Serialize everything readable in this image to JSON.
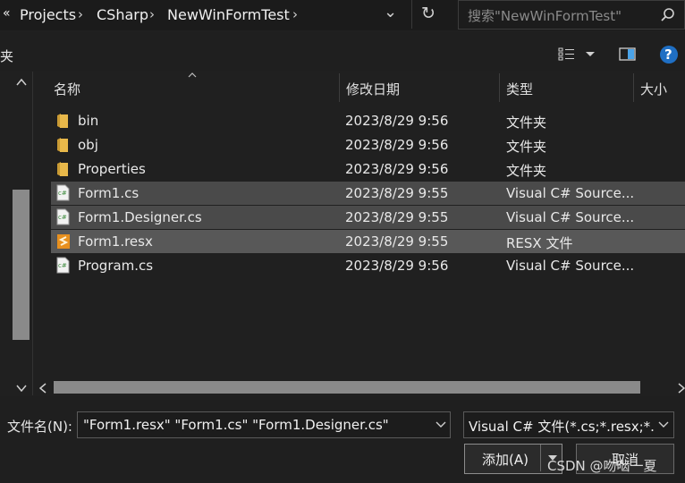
{
  "address": {
    "overflow": "«",
    "crumbs": [
      "Projects",
      "CSharp",
      "NewWinFormTest"
    ],
    "separator": "›",
    "dropdown": "⌄",
    "refresh": "↻"
  },
  "search": {
    "placeholder": "搜索\"NewWinFormTest\""
  },
  "toolbar": {
    "left_label": "夹",
    "help": "?"
  },
  "columns": {
    "name": "名称",
    "modified": "修改日期",
    "type": "类型",
    "size": "大小"
  },
  "files": [
    {
      "name": "bin",
      "modified": "2023/8/29 9:56",
      "type": "文件夹",
      "icon": "folder-icon",
      "selected": false
    },
    {
      "name": "obj",
      "modified": "2023/8/29 9:56",
      "type": "文件夹",
      "icon": "folder-icon",
      "selected": false
    },
    {
      "name": "Properties",
      "modified": "2023/8/29 9:56",
      "type": "文件夹",
      "icon": "folder-icon",
      "selected": false
    },
    {
      "name": "Form1.cs",
      "modified": "2023/8/29 9:55",
      "type": "Visual C# Source...",
      "icon": "csharp-file-icon",
      "selected": true
    },
    {
      "name": "Form1.Designer.cs",
      "modified": "2023/8/29 9:55",
      "type": "Visual C# Source...",
      "icon": "csharp-file-icon",
      "selected": true
    },
    {
      "name": "Form1.resx",
      "modified": "2023/8/29 9:55",
      "type": "RESX 文件",
      "icon": "resx-file-icon",
      "selected": true
    },
    {
      "name": "Program.cs",
      "modified": "2023/8/29 9:56",
      "type": "Visual C# Source...",
      "icon": "csharp-file-icon",
      "selected": false
    }
  ],
  "filename": {
    "label": "文件名(N):",
    "value": "\"Form1.resx\" \"Form1.cs\" \"Form1.Designer.cs\""
  },
  "filetype": {
    "value": "Visual C# 文件(*.cs;*.resx;*.re"
  },
  "buttons": {
    "add": "添加(A)",
    "cancel": "取消"
  },
  "watermark": "CSDN @吻啮一夏",
  "colors": {
    "background": "#202020",
    "selection": "#4a4a4a",
    "help_blue": "#1f6fc4",
    "folder": "#e8b84a"
  }
}
